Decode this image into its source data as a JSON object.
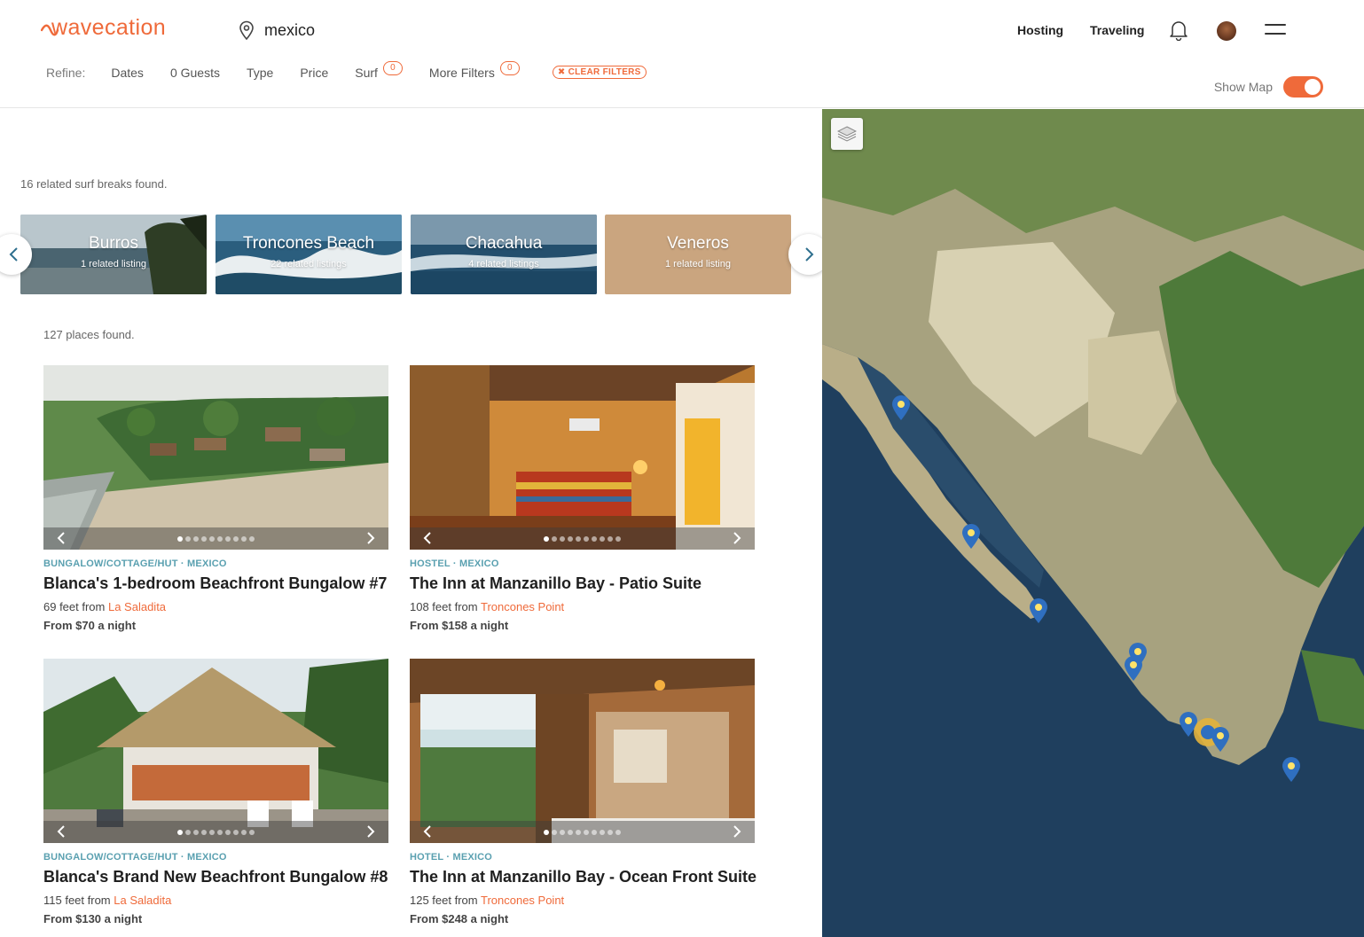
{
  "brand": {
    "name": "wavecation",
    "accent": "#ef6a3a",
    "link_color": "#5aa0b0"
  },
  "search": {
    "value": "mexico",
    "icon": "location-pin-icon"
  },
  "nav": {
    "hosting": "Hosting",
    "traveling": "Traveling",
    "bell_icon": "bell-icon",
    "menu_icon": "hamburger-menu-icon"
  },
  "refine": {
    "label": "Refine:",
    "dates": "Dates",
    "guests": "0 Guests",
    "type": "Type",
    "price": "Price",
    "surf": "Surf",
    "surf_count": "0",
    "more_filters": "More Filters",
    "more_filters_count": "0",
    "clear_filters": "CLEAR FILTERS"
  },
  "show_map": {
    "label": "Show Map",
    "on": true
  },
  "surf_breaks": {
    "count_text": "16 related surf breaks found.",
    "items": [
      {
        "name": "Burros",
        "sub": "1 related listing"
      },
      {
        "name": "Troncones Beach",
        "sub": "22 related listings"
      },
      {
        "name": "Chacahua",
        "sub": "4 related listings"
      },
      {
        "name": "Veneros",
        "sub": "1 related listing"
      }
    ]
  },
  "places": {
    "count_text": "127 places found.",
    "items": [
      {
        "type": "BUNGALOW/COTTAGE/HUT · MEXICO",
        "title": "Blanca's 1-bedroom Beachfront Bungalow #7",
        "dist_prefix": "69 feet from ",
        "spot": "La Saladita",
        "price": "From $70 a night"
      },
      {
        "type": "HOSTEL · MEXICO",
        "title": "The Inn at Manzanillo Bay - Patio Suite",
        "dist_prefix": "108 feet from ",
        "spot": "Troncones Point",
        "price": "From $158 a night"
      },
      {
        "type": "BUNGALOW/COTTAGE/HUT · MEXICO",
        "title": "Blanca's Brand New Beachfront Bungalow #8",
        "dist_prefix": "115 feet from ",
        "spot": "La Saladita",
        "price": "From $130 a night"
      },
      {
        "type": "HOTEL · MEXICO",
        "title": "The Inn at Manzanillo Bay - Ocean Front Suite",
        "dist_prefix": "125 feet from ",
        "spot": "Troncones Point",
        "price": "From $248 a night"
      }
    ]
  },
  "map": {
    "layers_icon": "layers-icon"
  }
}
